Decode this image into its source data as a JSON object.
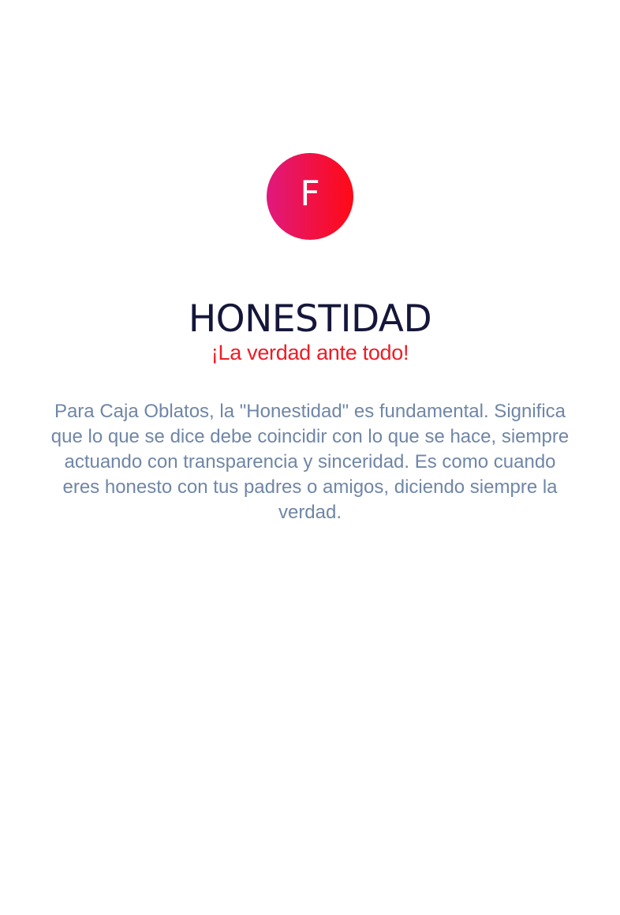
{
  "badge": {
    "letter": "F"
  },
  "heading": {
    "title": "HONESTIDAD",
    "subtitle": "¡La verdad ante todo!"
  },
  "description": "Para Caja Oblatos, la \"Honestidad\" es fundamental. Significa que lo que se dice debe coincidir con lo que se hace, siempre actuando con transparencia y sinceridad. Es como cuando eres honesto con tus padres o amigos, diciendo siempre la verdad.",
  "colors": {
    "title": "#15163a",
    "accent": "#ee1c25",
    "badge_gradient_start": "#e0197d",
    "badge_gradient_end": "#ff0a14",
    "body_text": "#6f86a7"
  }
}
